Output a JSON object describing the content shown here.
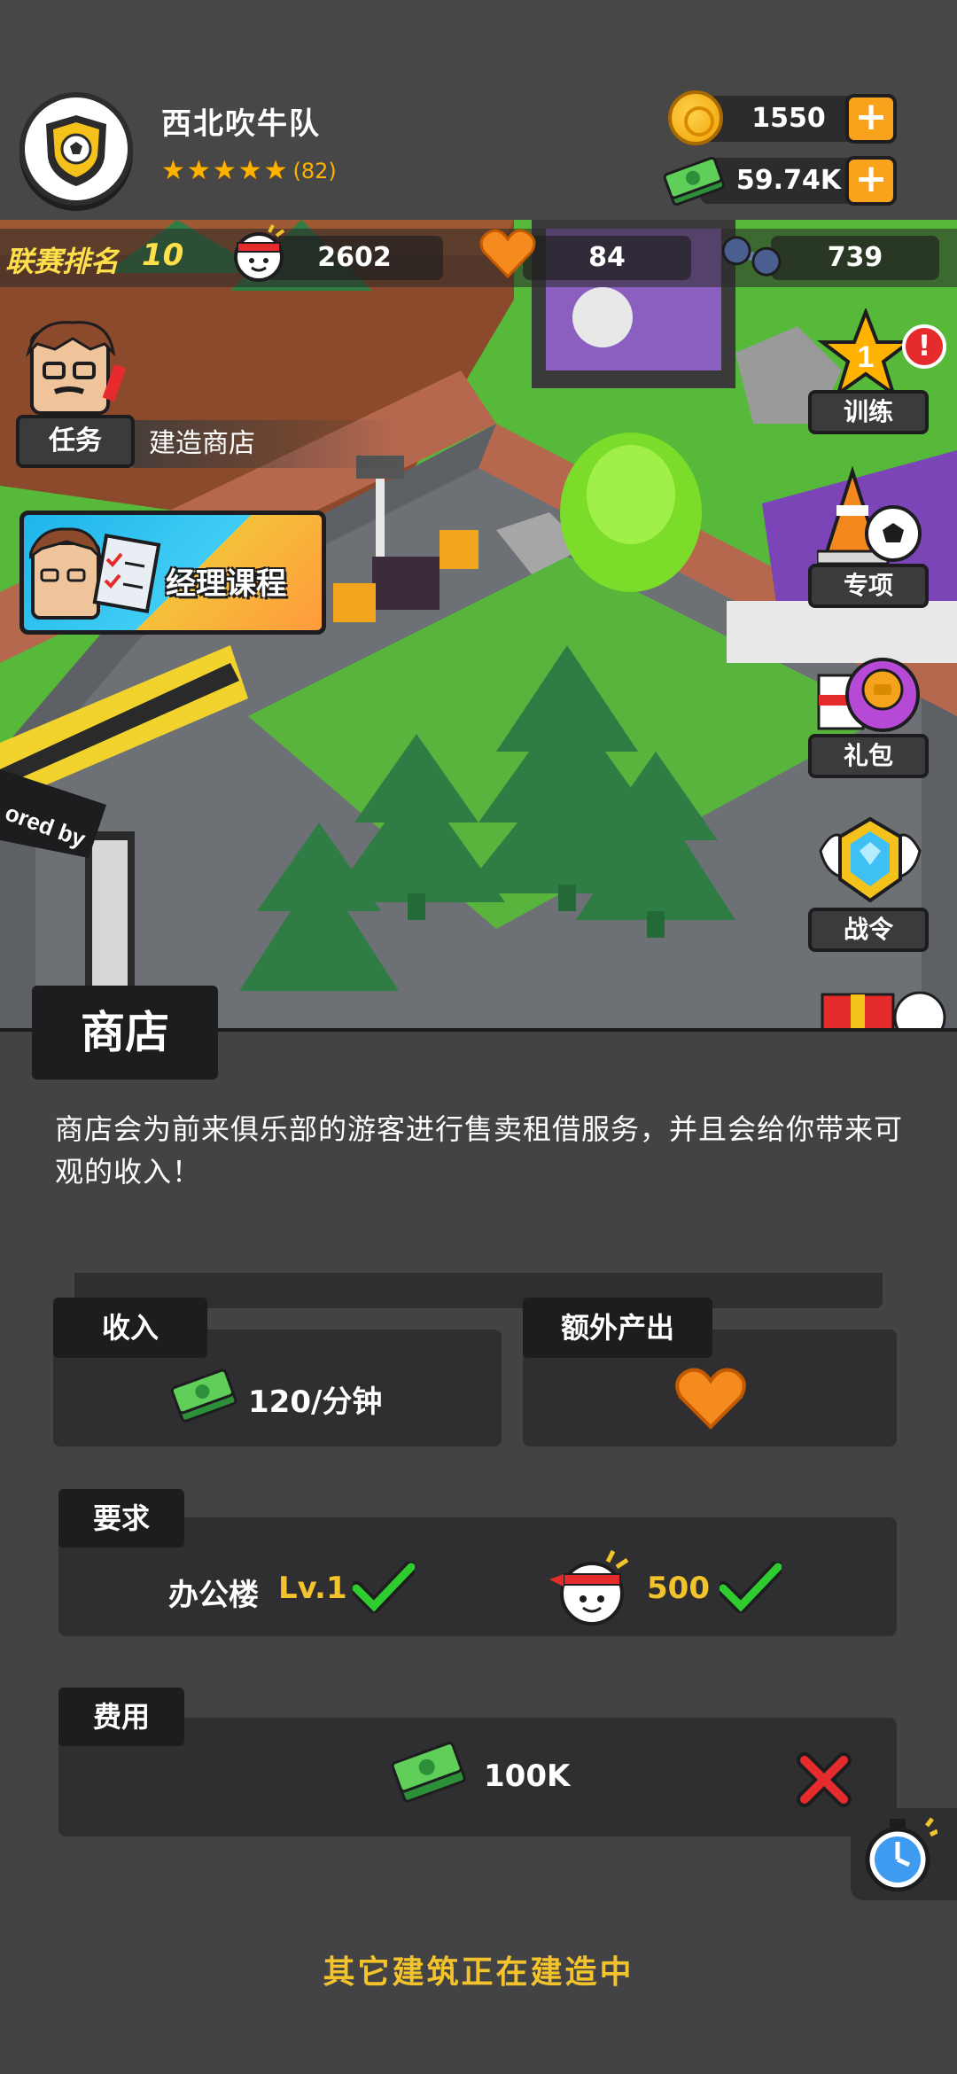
{
  "header": {
    "club_name": "西北吹牛队",
    "stars": 5,
    "rating": "(82)",
    "coins": "1550",
    "cash": "59.74K"
  },
  "league": {
    "label": "联赛排名",
    "rank": "10",
    "fans": "2602",
    "hearts": "84",
    "dumbbells": "739"
  },
  "task": {
    "button_label": "任务",
    "description": "建造商店"
  },
  "manager_course": {
    "label": "经理课程"
  },
  "side_menu": {
    "training": "训练",
    "training_badge": "1",
    "alert": "!",
    "special": "专项",
    "gift_pack": "礼包",
    "battle_pass": "战令"
  },
  "scene": {
    "banner_text": "ored by"
  },
  "shop": {
    "title": "商店",
    "description": "商店会为前来俱乐部的游客进行售卖租借服务，并且会给你带来可观的收入！",
    "income_label": "收入",
    "income_value": "120/分钟",
    "extra_output_label": "额外产出",
    "requirements_label": "要求",
    "req_building": "办公楼",
    "req_building_level": "Lv.1",
    "req_fans": "500",
    "cost_label": "费用",
    "cost_value": "100K",
    "status": "其它建筑正在建造中"
  },
  "colors": {
    "accent_yellow": "#f2c32a",
    "panel_bg": "#434345",
    "box_bg": "#2f2f31",
    "plus_orange": "#f9a21c",
    "check_green": "#2ecc2e",
    "cancel_red": "#e52b2b"
  }
}
